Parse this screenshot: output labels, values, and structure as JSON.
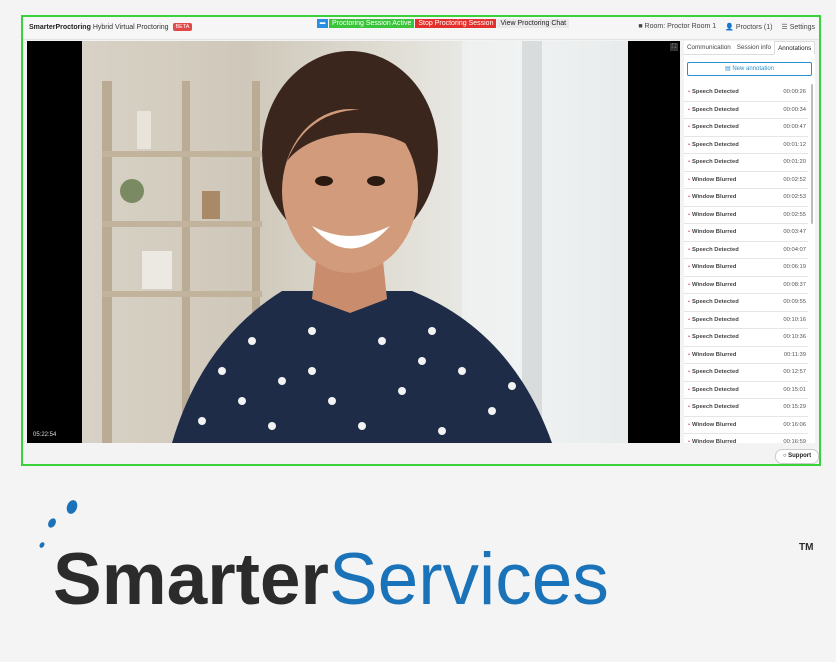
{
  "topbar": {
    "brand_bold": "SmarterProctoring",
    "brand_rest": "Hybrid Virtual Proctoring",
    "beta": "BETA",
    "camera_label": "cam",
    "session_active": "Proctoring Session Active",
    "stop_session": "Stop Proctoring Session",
    "view_chat": "View Proctoring Chat",
    "room": "Room: Proctor Room 1",
    "proctors": "Proctors (1)",
    "settings": "Settings"
  },
  "video": {
    "timer": "05:22:54"
  },
  "panel": {
    "tabs": [
      "Communication",
      "Session info",
      "Annotations"
    ],
    "new_annotation": "New annotation",
    "annotations": [
      {
        "type": "Speech Detected",
        "time": "00:00:26"
      },
      {
        "type": "Speech Detected",
        "time": "00:00:34"
      },
      {
        "type": "Speech Detected",
        "time": "00:00:47"
      },
      {
        "type": "Speech Detected",
        "time": "00:01:12"
      },
      {
        "type": "Speech Detected",
        "time": "00:01:20"
      },
      {
        "type": "Window Blurred",
        "time": "00:02:52"
      },
      {
        "type": "Window Blurred",
        "time": "00:02:53"
      },
      {
        "type": "Window Blurred",
        "time": "00:02:55"
      },
      {
        "type": "Window Blurred",
        "time": "00:03:47"
      },
      {
        "type": "Speech Detected",
        "time": "00:04:07"
      },
      {
        "type": "Window Blurred",
        "time": "00:06:19"
      },
      {
        "type": "Window Blurred",
        "time": "00:08:37"
      },
      {
        "type": "Speech Detected",
        "time": "00:09:55"
      },
      {
        "type": "Speech Detected",
        "time": "00:10:16"
      },
      {
        "type": "Speech Detected",
        "time": "00:10:36"
      },
      {
        "type": "Window Blurred",
        "time": "00:11:39"
      },
      {
        "type": "Speech Detected",
        "time": "00:12:57"
      },
      {
        "type": "Speech Detected",
        "time": "00:15:01"
      },
      {
        "type": "Speech Detected",
        "time": "00:15:29"
      },
      {
        "type": "Window Blurred",
        "time": "00:16:06"
      },
      {
        "type": "Window Blurred",
        "time": "00:16:59"
      }
    ]
  },
  "support": "Support",
  "logo": {
    "part1": "Smarter",
    "part2": "Services",
    "tm": "TM"
  },
  "colors": {
    "frame_border": "#3bd13b",
    "active_green": "#39c43a",
    "stop_red": "#e2312c",
    "accent_blue": "#2a8ed2",
    "logo_blue": "#1a72b8",
    "logo_dark": "#2b2b2b"
  }
}
